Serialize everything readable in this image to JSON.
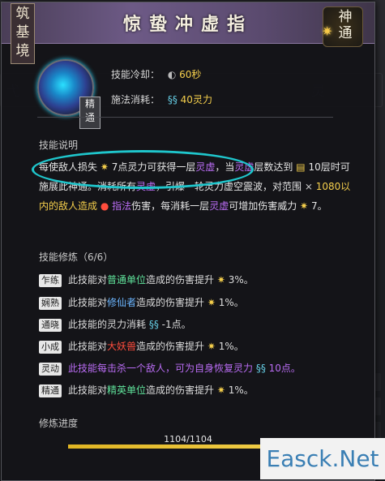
{
  "tooltip": {
    "title": "惊蛰冲虚指",
    "realm": "筑\n基\n境",
    "divine_label": "神\n通",
    "icon_badge": "精\n通",
    "cooldown_label": "技能冷却：",
    "cooldown_value": "60秒",
    "cost_label": "施法消耗：",
    "cost_value": "40灵力",
    "description_title": "技能说明",
    "description": {
      "p1": "每使敌人损失",
      "p2": "7点灵力可获得一层",
      "p3": "灵虚",
      "p4": "，当",
      "p5": "灵虚",
      "p6": "层数达到",
      "p7": "10层时可施展此神通。消耗所有",
      "p8": "灵虚",
      "p9": "，引爆一轮灵力虚空震波，对范围",
      "p10": "1080以内的敌人造成",
      "p11": "指法",
      "p12": "伤害，每消耗一层",
      "p13": "灵虚",
      "p14": "可增加伤害威力",
      "p15": "7。"
    },
    "cultivation_title": "技能修炼（6/6）",
    "cultivation": [
      {
        "badge": "乍练",
        "pre": "此技能对",
        "hl": "普通单位",
        "post": "造成的伤害提升",
        "val": "3%。",
        "color": "green"
      },
      {
        "badge": "娴熟",
        "pre": "此技能对",
        "hl": "修仙者",
        "post": "造成的伤害提升",
        "val": "1%。",
        "color": "blue"
      },
      {
        "badge": "通晓",
        "pre": "此技能的灵力消耗",
        "hl": "",
        "post": "",
        "val": "-1点。",
        "color": "none"
      },
      {
        "badge": "小成",
        "pre": "此技能对",
        "hl": "大妖兽",
        "post": "造成的伤害提升",
        "val": "1%。",
        "color": "red"
      },
      {
        "badge": "灵动",
        "pre": "",
        "hl": "此技能每击杀一个敌人，可为自身恢复灵力",
        "post": "",
        "val": "10点。",
        "color": "purple"
      },
      {
        "badge": "精通",
        "pre": "此技能对",
        "hl": "精英单位",
        "post": "造成的伤害提升",
        "val": "1%。",
        "color": "green"
      }
    ],
    "progress_title": "修炼进度",
    "progress_text": "1104/1104",
    "progress_fraction": 1.0
  },
  "watermark": "Easck.Net"
}
